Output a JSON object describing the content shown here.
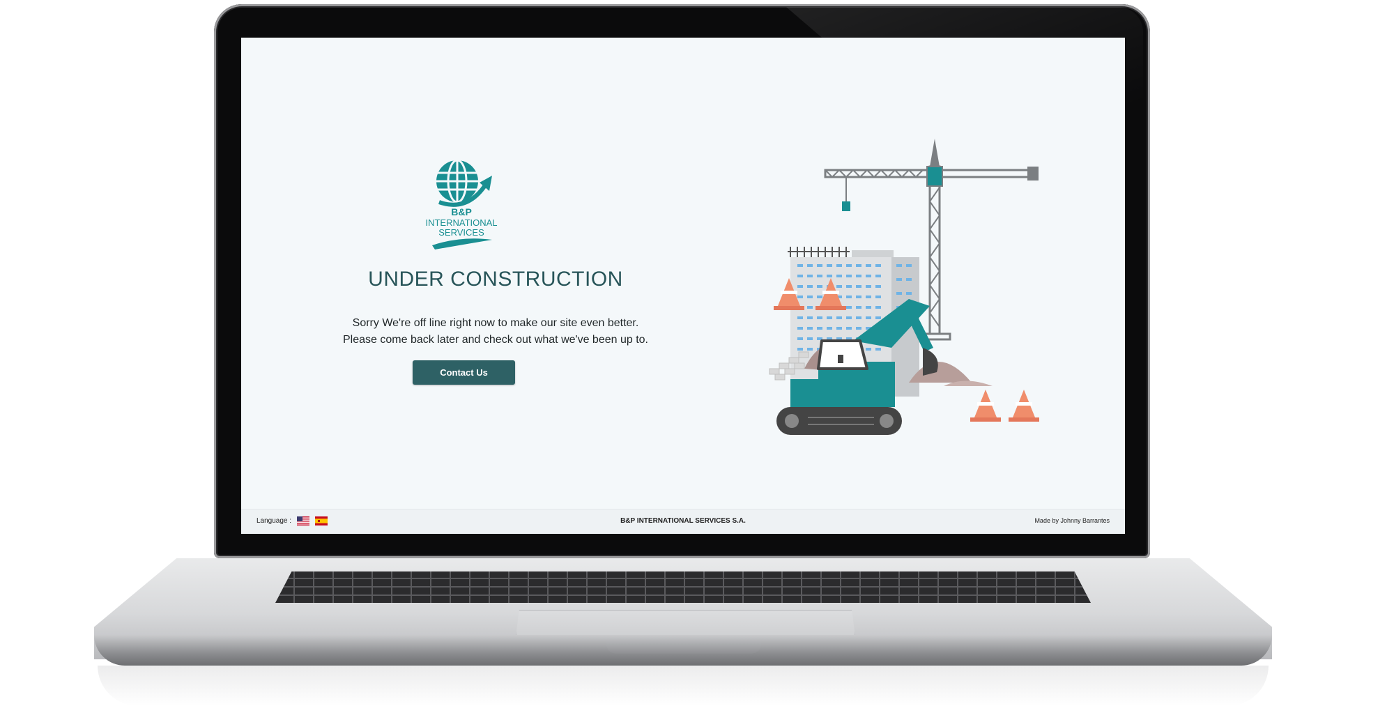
{
  "page": {
    "heading": "UNDER CONSTRUCTION",
    "message_line1": "Sorry We're off line right now to make our site even better.",
    "message_line2": "Please come back later and check out what we've been up to.",
    "contact_button": "Contact Us"
  },
  "logo": {
    "line1": "B&P",
    "line2": "INTERNATIONAL",
    "line3": "SERVICES"
  },
  "footer": {
    "language_label": "Language :",
    "languages": [
      {
        "icon": "us-flag-icon"
      },
      {
        "icon": "spain-flag-icon"
      }
    ],
    "company": "B&P INTERNATIONAL SERVICES S.A.",
    "credit": "Made by Johnny Barrantes"
  },
  "colors": {
    "accent": "#2e6165",
    "teal": "#1a8f92",
    "heading": "#285559",
    "screen_bg": "#f4f8fa"
  }
}
